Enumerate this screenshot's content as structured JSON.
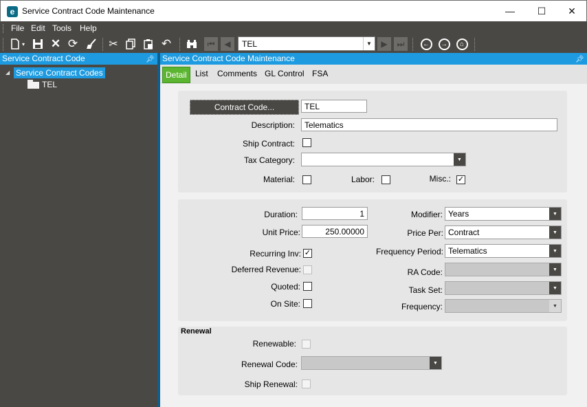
{
  "window": {
    "title": "Service Contract Code Maintenance",
    "logo_letter": "e",
    "minimize": "—",
    "maximize": "☐",
    "close": "✕"
  },
  "menu": [
    "File",
    "Edit",
    "Tools",
    "Help"
  ],
  "toolbar": {
    "key_value": "TEL",
    "icons": [
      "new-icon",
      "save-icon",
      "delete-icon",
      "refresh-icon",
      "clear-icon",
      "cut-icon",
      "copy-icon",
      "paste-icon",
      "undo-icon",
      "search-icon",
      "first-icon",
      "prev-icon",
      "next-icon",
      "last-icon",
      "back-icon",
      "forward-icon",
      "home-icon"
    ]
  },
  "left_panel": {
    "title": "Service Contract Code",
    "tree_root": "Service Contract Codes",
    "tree_child": "TEL"
  },
  "right_panel": {
    "title": "Service Contract Code Maintenance",
    "tabs": [
      "Detail",
      "List",
      "Comments",
      "GL Control",
      "FSA"
    ],
    "active_tab": "Detail"
  },
  "form": {
    "contract_code_button": "Contract Code...",
    "contract_code_value": "TEL",
    "description_label": "Description:",
    "description_value": "Telematics",
    "ship_contract_label": "Ship Contract:",
    "ship_contract_checked": false,
    "tax_category_label": "Tax Category:",
    "tax_category_value": "",
    "material_label": "Material:",
    "material_checked": false,
    "labor_label": "Labor:",
    "labor_checked": false,
    "misc_label": "Misc.:",
    "misc_checked": true,
    "duration_label": "Duration:",
    "duration_value": "1",
    "unit_price_label": "Unit Price:",
    "unit_price_value": "250.00000",
    "recurring_label": "Recurring Inv:",
    "recurring_checked": true,
    "deferred_label": "Deferred Revenue:",
    "quoted_label": "Quoted:",
    "on_site_label": "On Site:",
    "modifier_label": "Modifier:",
    "modifier_value": "Years",
    "price_per_label": "Price Per:",
    "price_per_value": "Contract",
    "frequency_period_label": "Frequency Period:",
    "frequency_period_value": "Telematics",
    "ra_code_label": "RA Code:",
    "task_set_label": "Task Set:",
    "frequency_label": "Frequency:",
    "renewal_title": "Renewal",
    "renewable_label": "Renewable:",
    "renewal_code_label": "Renewal Code:",
    "ship_renewal_label": "Ship Renewal:",
    "check_mark": "✓"
  }
}
